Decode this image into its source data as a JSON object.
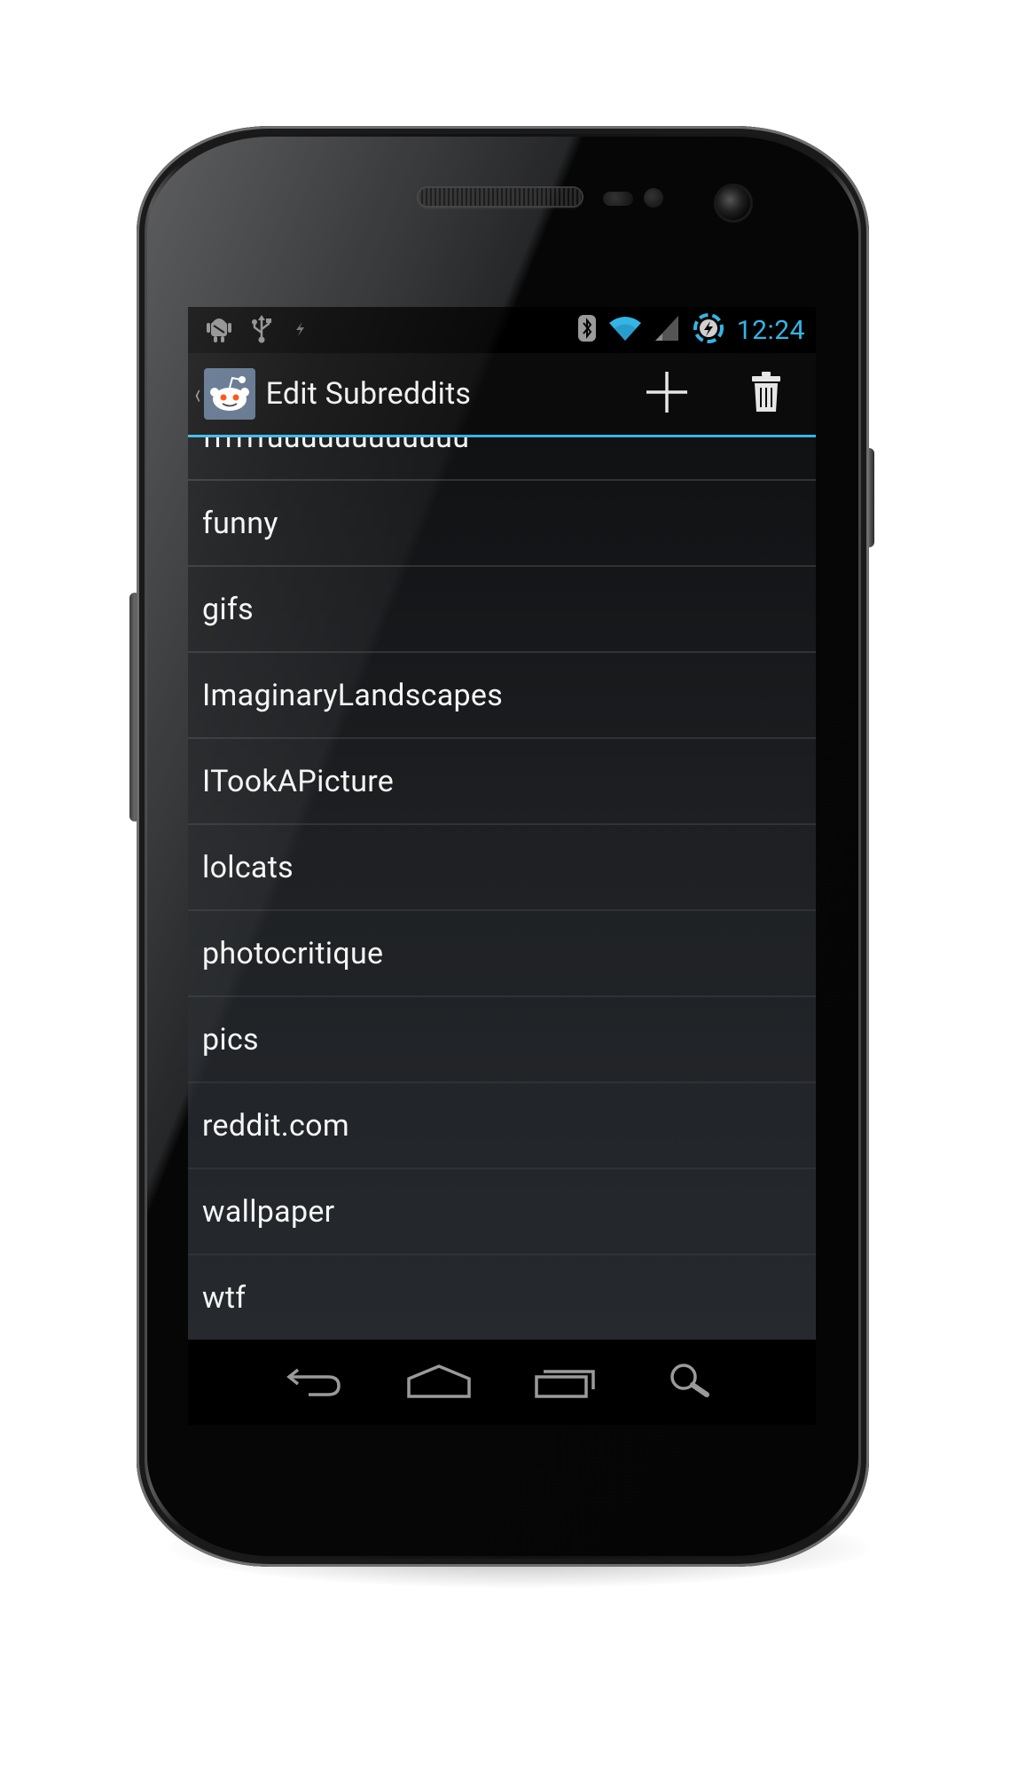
{
  "status_bar": {
    "time": "12:24",
    "left_icons": [
      "android-debug-icon",
      "usb-icon",
      "charging-icon"
    ],
    "right_icons": [
      "bluetooth-icon",
      "wifi-icon",
      "signal-icon",
      "sync-icon"
    ]
  },
  "action_bar": {
    "title": "Edit Subreddits",
    "up_caret": "‹",
    "actions": [
      "add-icon",
      "delete-icon"
    ]
  },
  "subreddits": [
    "ffffffuuuuuuuuuuuu",
    "funny",
    "gifs",
    "ImaginaryLandscapes",
    "ITookAPicture",
    "lolcats",
    "photocritique",
    "pics",
    "reddit.com",
    "wallpaper",
    "wtf"
  ],
  "nav_bar": [
    "back-icon",
    "home-icon",
    "recent-apps-icon",
    "search-icon"
  ],
  "colors": {
    "accent": "#33b5e5",
    "list_bg": "#1f2124",
    "text": "#f5f5f5"
  }
}
